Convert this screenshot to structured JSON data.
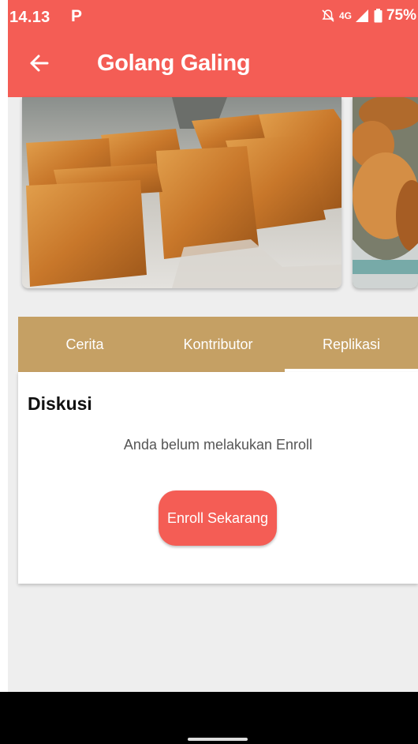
{
  "status_bar": {
    "time": "14.13",
    "notification_icon": "P",
    "network": "4G",
    "battery": "75%"
  },
  "app_bar": {
    "back_icon": "arrow-left",
    "title": "Golang Galing"
  },
  "carousel": {
    "images": [
      "food-photo-fried-squares",
      "food-photo-fried-dough"
    ]
  },
  "tabs": [
    {
      "label": "Cerita",
      "active": false
    },
    {
      "label": "Kontributor",
      "active": false
    },
    {
      "label": "Replikasi",
      "active": true
    }
  ],
  "discussion": {
    "heading": "Diskusi",
    "notice": "Anda belum melakukan Enroll",
    "enroll_button": "Enroll Sekarang"
  },
  "colors": {
    "primary": "#f45d55",
    "tab_bar": "#c5a064",
    "background": "#eeeeee"
  }
}
